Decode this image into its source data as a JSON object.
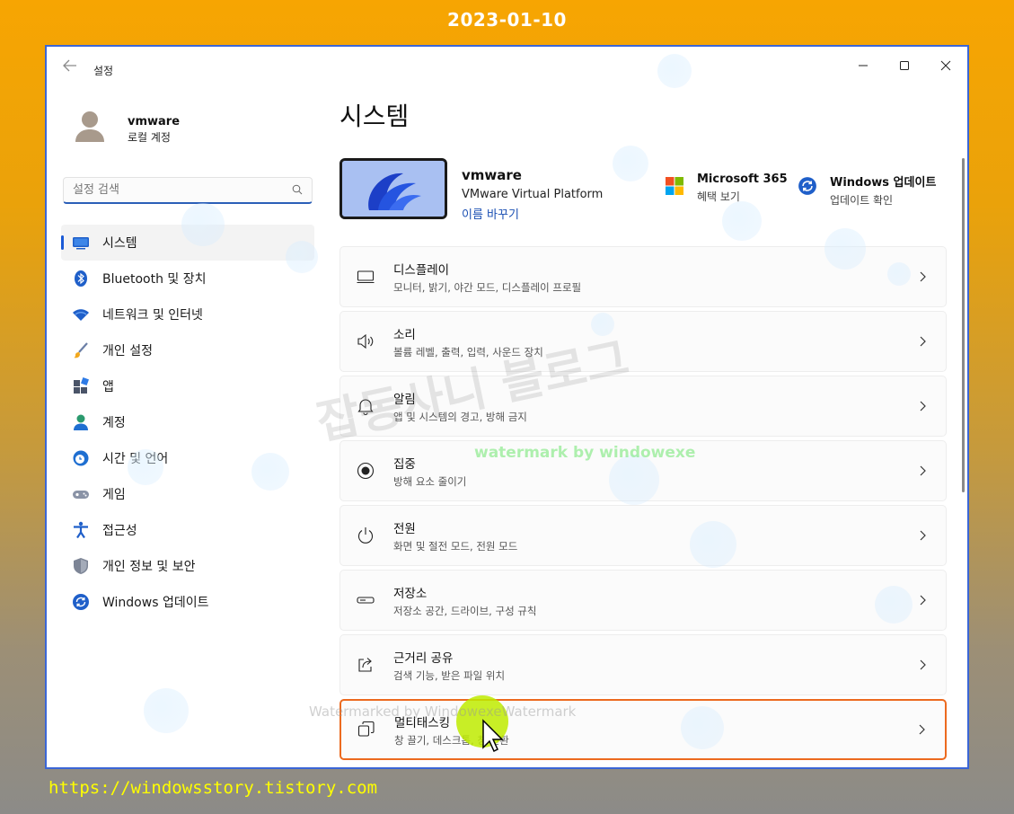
{
  "header_date": "2023-01-10",
  "footer_url": "https://windowsstory.tistory.com",
  "window": {
    "title": "설정",
    "minimize_icon": "minimize-icon",
    "maximize_icon": "maximize-icon",
    "close_icon": "close-icon"
  },
  "profile": {
    "name": "vmware",
    "account_type": "로컬 계정"
  },
  "search": {
    "placeholder": "설정 검색"
  },
  "sidebar": {
    "active_index": 0,
    "items": [
      {
        "label": "시스템",
        "icon": "monitor-icon"
      },
      {
        "label": "Bluetooth 및 장치",
        "icon": "bluetooth-icon"
      },
      {
        "label": "네트워크 및 인터넷",
        "icon": "wifi-icon"
      },
      {
        "label": "개인 설정",
        "icon": "brush-icon"
      },
      {
        "label": "앱",
        "icon": "apps-icon"
      },
      {
        "label": "계정",
        "icon": "person-icon"
      },
      {
        "label": "시간 및 언어",
        "icon": "globe-clock-icon"
      },
      {
        "label": "게임",
        "icon": "gamepad-icon"
      },
      {
        "label": "접근성",
        "icon": "accessibility-icon"
      },
      {
        "label": "개인 정보 및 보안",
        "icon": "shield-icon"
      },
      {
        "label": "Windows 업데이트",
        "icon": "update-icon"
      }
    ]
  },
  "main": {
    "title": "시스템",
    "device": {
      "name": "vmware",
      "model": "VMware Virtual Platform",
      "rename": "이름 바꾸기"
    },
    "quick_links": [
      {
        "title": "Microsoft 365",
        "sub": "혜택 보기",
        "icon": "microsoft-logo-icon"
      },
      {
        "title": "Windows 업데이트",
        "sub": "업데이트 확인",
        "icon": "update-icon"
      }
    ],
    "cards": [
      {
        "title": "디스플레이",
        "sub": "모니터, 밝기, 야간 모드, 디스플레이 프로필",
        "icon": "display-icon"
      },
      {
        "title": "소리",
        "sub": "볼륨 레벨, 출력, 입력, 사운드 장치",
        "icon": "speaker-icon"
      },
      {
        "title": "알림",
        "sub": "앱 및 시스템의 경고, 방해 금지",
        "icon": "bell-icon"
      },
      {
        "title": "집중",
        "sub": "방해 요소 줄이기",
        "icon": "focus-icon"
      },
      {
        "title": "전원",
        "sub": "화면 및 절전 모드, 전원 모드",
        "icon": "power-icon"
      },
      {
        "title": "저장소",
        "sub": "저장소 공간, 드라이브, 구성 규칙",
        "icon": "storage-icon"
      },
      {
        "title": "근거리 공유",
        "sub": "검색 기능, 받은 파일 위치",
        "icon": "share-icon"
      },
      {
        "title": "멀티태스킹",
        "sub": "창 끌기, 데스크톱, 창 전환",
        "icon": "multitask-icon"
      }
    ]
  },
  "watermarks": {
    "big": "잡동사니 블로그",
    "green": "watermark by windowexe",
    "bottom": "Watermarked by WindowexeWatermark"
  },
  "colors": {
    "accent": "#1a5ad6",
    "highlight_border": "#ec6a1f",
    "footer_url": "#ffff00"
  }
}
